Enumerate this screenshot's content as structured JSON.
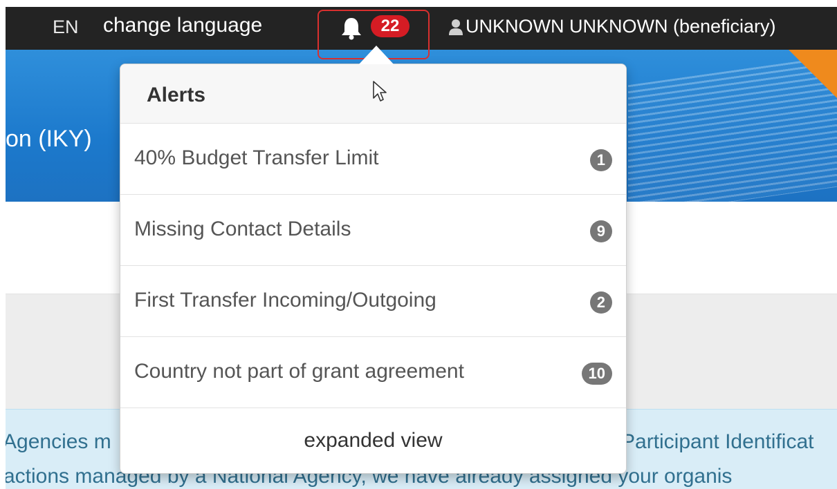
{
  "topbar": {
    "lang_code": "EN",
    "change_language": "change language",
    "notification_count": "22",
    "user_label": "UNKNOWN UNKNOWN (beneficiary)",
    "icons": {
      "bell": "bell-icon",
      "user": "user-icon"
    }
  },
  "banner": {
    "title_fragment": "on (IKY)"
  },
  "alerts": {
    "title": "Alerts",
    "items": [
      {
        "label": "40% Budget Transfer Limit",
        "count": "1"
      },
      {
        "label": "Missing Contact Details",
        "count": "9"
      },
      {
        "label": "First Transfer Incoming/Outgoing",
        "count": "2"
      },
      {
        "label": "Country not part of grant agreement",
        "count": "10"
      }
    ],
    "footer_link": "expanded view"
  },
  "info": {
    "line1_left": "Agencies m",
    "line1_right": "Participant Identificat",
    "line2": "actions managed by a National Agency, we have already assigned your organis"
  },
  "colors": {
    "topbar_bg": "#232323",
    "banner_blue": "#1c79cc",
    "notification_red": "#d51c24",
    "highlight_box": "#d9302f",
    "badge_grey": "#777777",
    "info_bg": "#d9edf7",
    "info_text": "#31708f",
    "orange_accent": "#ef8a1d"
  }
}
